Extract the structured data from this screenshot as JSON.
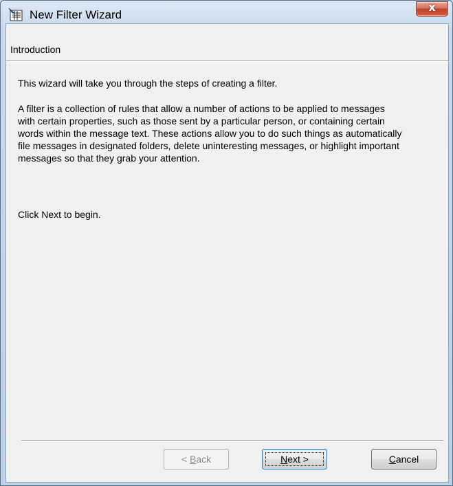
{
  "window": {
    "title": "New Filter Wizard",
    "close_glyph": "x"
  },
  "page": {
    "section_title": "Introduction",
    "paragraphs": [
      "This wizard will take you through the steps of creating a filter.",
      "A filter is a collection of rules that allow a number of actions to be applied to messages with certain properties, such as those sent by a particular person, or containing certain words within the message text. These actions allow you to do such things as automatically file messages in designated folders, delete uninteresting messages, or highlight important messages so that they grab your attention.",
      "Click Next to begin."
    ]
  },
  "buttons": {
    "back": {
      "prefix": "< ",
      "accel": "B",
      "rest": "ack"
    },
    "next": {
      "accel": "N",
      "rest": "ext >"
    },
    "cancel": {
      "accel": "C",
      "rest": "ancel"
    }
  },
  "icons": {
    "app": "filter-wizard-icon",
    "close": "close-icon"
  },
  "colors": {
    "close_button": "#c2412a",
    "default_button_border": "#3c7fb1"
  }
}
